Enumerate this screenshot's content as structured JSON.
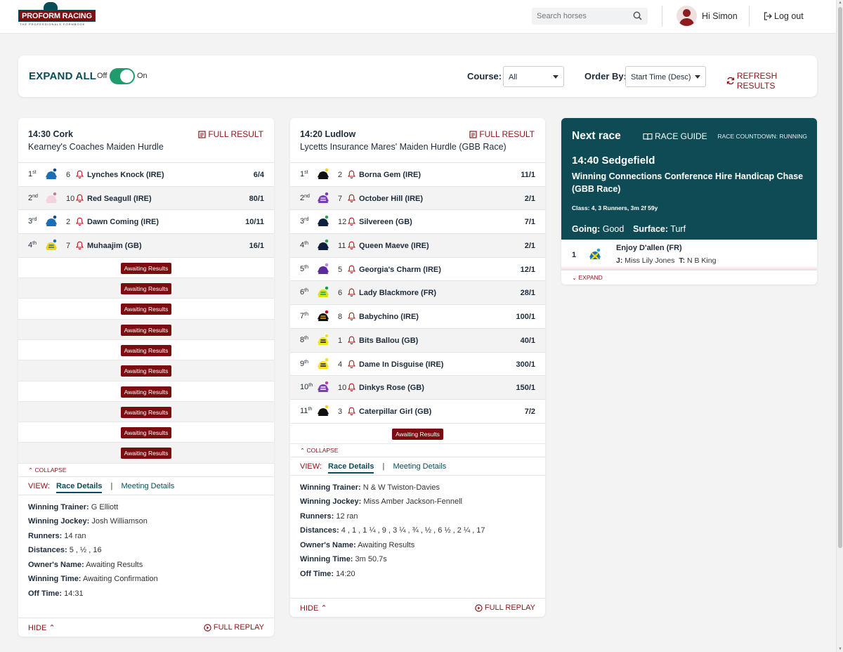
{
  "header": {
    "logo_text": "PROFORM RACING",
    "logo_tagline": "THE PROFESSIONALS FORMBOOK",
    "search_placeholder": "Search horses",
    "greeting": "Hi Simon",
    "logout_label": "Log out"
  },
  "filters": {
    "expand_all_label": "EXPAND ALL",
    "toggle_off": "Off",
    "toggle_on": "On",
    "toggle_state": "on",
    "course_label": "Course:",
    "course_value": "All",
    "order_label": "Order By:",
    "order_value": "Start Time (Desc)",
    "refresh_label": "REFRESH RESULTS"
  },
  "races": [
    {
      "time_course": "14:30 Cork",
      "name": "Kearney's Coaches Maiden Hurdle",
      "full_result_label": "FULL RESULT",
      "runners": [
        {
          "pos": "1",
          "suffix": "st",
          "num": "6",
          "horse": "Lynches Knock (IRE)",
          "odds": "6/4",
          "silk": "blue"
        },
        {
          "pos": "2",
          "suffix": "nd",
          "num": "10",
          "horse": "Red Seagull (IRE)",
          "odds": "80/1",
          "silk": "pink"
        },
        {
          "pos": "3",
          "suffix": "rd",
          "num": "2",
          "horse": "Dawn Coming (IRE)",
          "odds": "10/11",
          "silk": "blue"
        },
        {
          "pos": "4",
          "suffix": "th",
          "num": "7",
          "horse": "Muhaajim (GB)",
          "odds": "16/1",
          "silk": "yellowblue"
        }
      ],
      "awaiting": [
        "Awaiting Results",
        "Awaiting Results",
        "Awaiting Results",
        "Awaiting Results",
        "Awaiting Results",
        "Awaiting Results",
        "Awaiting Results",
        "Awaiting Results",
        "Awaiting Results",
        "Awaiting Results"
      ],
      "collapse_label": "COLLAPSE",
      "view_label": "VIEW:",
      "tab_race": "Race Details",
      "tab_meeting": "Meeting Details",
      "details": {
        "trainer_label": "Winning Trainer:",
        "trainer": "G Elliott",
        "jockey_label": "Winning Jockey:",
        "jockey": "Josh Williamson",
        "runners_label": "Runners:",
        "runners": "14 ran",
        "distances_label": "Distances:",
        "distances": "5 , ½ , 16",
        "owner_label": "Owner's Name:",
        "owner": "Awaiting Results",
        "time_label": "Winning Time:",
        "time": "Awaiting Confirmation",
        "off_label": "Off Time:",
        "off": "14:31"
      },
      "hide_label": "HIDE",
      "replay_label": "FULL REPLAY"
    },
    {
      "time_course": "14:20 Ludlow",
      "name": "Lycetts Insurance Mares' Maiden Hurdle (GBB Race)",
      "full_result_label": "FULL RESULT",
      "runners": [
        {
          "pos": "1",
          "suffix": "st",
          "num": "2",
          "horse": "Borna Gem (IRE)",
          "odds": "11/1",
          "silk": "black"
        },
        {
          "pos": "2",
          "suffix": "nd",
          "num": "7",
          "horse": "October Hill (IRE)",
          "odds": "2/1",
          "silk": "purplecheck"
        },
        {
          "pos": "3",
          "suffix": "rd",
          "num": "12",
          "horse": "Silvereen (GB)",
          "odds": "7/1",
          "silk": "navy"
        },
        {
          "pos": "4",
          "suffix": "th",
          "num": "11",
          "horse": "Queen Maeve (IRE)",
          "odds": "2/1",
          "silk": "navy"
        },
        {
          "pos": "5",
          "suffix": "th",
          "num": "5",
          "horse": "Georgia's Charm (IRE)",
          "odds": "12/1",
          "silk": "purple"
        },
        {
          "pos": "6",
          "suffix": "th",
          "num": "6",
          "horse": "Lady Blackmore (FR)",
          "odds": "28/1",
          "silk": "yellowgreen"
        },
        {
          "pos": "7",
          "suffix": "th",
          "num": "8",
          "horse": "Babychino (IRE)",
          "odds": "100/1",
          "silk": "stripe"
        },
        {
          "pos": "8",
          "suffix": "th",
          "num": "1",
          "horse": "Bits Ballou (GB)",
          "odds": "40/1",
          "silk": "yellowdots"
        },
        {
          "pos": "9",
          "suffix": "th",
          "num": "4",
          "horse": "Dame In Disguise (IRE)",
          "odds": "300/1",
          "silk": "yellowblack"
        },
        {
          "pos": "10",
          "suffix": "th",
          "num": "10",
          "horse": "Dinkys Rose (GB)",
          "odds": "150/1",
          "silk": "purplestripe"
        },
        {
          "pos": "11",
          "suffix": "th",
          "num": "3",
          "horse": "Caterpillar Girl (GB)",
          "odds": "7/2",
          "silk": "black"
        }
      ],
      "awaiting": [
        "Awaiting Results"
      ],
      "collapse_label": "COLLAPSE",
      "view_label": "VIEW:",
      "tab_race": "Race Details",
      "tab_meeting": "Meeting Details",
      "details": {
        "trainer_label": "Winning Trainer:",
        "trainer": "N & W Twiston-Davies",
        "jockey_label": "Winning Jockey:",
        "jockey": "Miss Amber Jackson-Fennell",
        "runners_label": "Runners:",
        "runners": "12 ran",
        "distances_label": "Distances:",
        "distances": "4 , 1 , 1 ¼ , 9 , 3 ¼ , ¾ , ½ , 6 ½ , 2 ¼ , 17",
        "owner_label": "Owner's Name:",
        "owner": "Awaiting Results",
        "time_label": "Winning Time:",
        "time": "3m 50.7s",
        "off_label": "Off Time:",
        "off": "14:20"
      },
      "hide_label": "HIDE",
      "replay_label": "FULL REPLAY"
    }
  ],
  "next_race": {
    "heading": "Next race",
    "guide_label": "RACE GUIDE",
    "countdown": "RACE COUNTDOWN: RUNNING",
    "time_course": "14:40 Sedgefield",
    "name": "Winning Connections Conference Hire Handicap Chase (GBB Race)",
    "class_info": "Class: 4, 3 Runners, 3m 2f 59y",
    "going_label": "Going:",
    "going": "Good",
    "surface_label": "Surface:",
    "surface": "Turf",
    "runner": {
      "num": "1",
      "horse": "Enjoy D'allen (FR)",
      "jockey_label": "J:",
      "jockey": "Miss Lily Jones",
      "trainer_label": "T:",
      "trainer": "N B King"
    },
    "expand_label": "EXPAND"
  },
  "colors": {
    "brand_teal": "#0f4b55",
    "brand_red": "#8b1418",
    "toggle_green": "#1f9c6c"
  }
}
